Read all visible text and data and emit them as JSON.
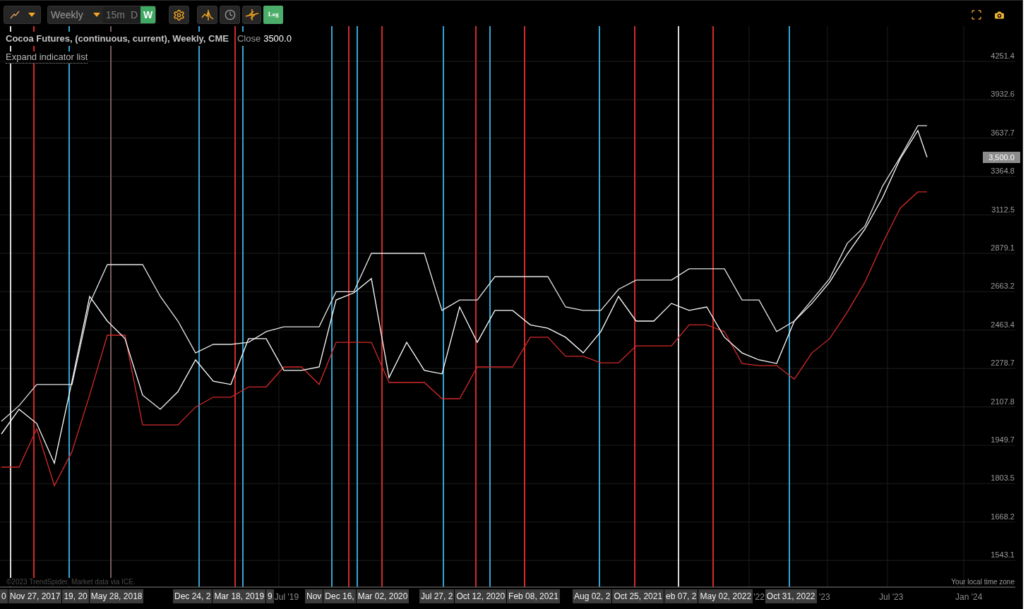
{
  "toolbar": {
    "interval_dropdown": "Weekly",
    "timeframes": [
      {
        "label": "15m",
        "selected": false
      },
      {
        "label": "D",
        "selected": false
      },
      {
        "label": "W",
        "selected": true
      }
    ],
    "log_toggle": {
      "label": "Log",
      "on": true
    }
  },
  "legend": {
    "title": "Cocoa Futures, (continuous, current), Weekly, CME",
    "close_label": "Close",
    "close_value": "3500.0",
    "expand_link": "Expand indicator list"
  },
  "price_axis": {
    "labels": [
      "4251.4",
      "3932.6",
      "3637.7",
      "3364.8",
      "3112.5",
      "2879.1",
      "2663.2",
      "2463.4",
      "2278.7",
      "2107.8",
      "1949.7",
      "1803.5",
      "1668.2",
      "1543.1"
    ],
    "last_price": "3,500.0"
  },
  "event_lines": [
    {
      "color": "#d9d9d9"
    },
    {
      "color": "#d42a2a"
    },
    {
      "color": "#34a6d4"
    },
    {
      "color": "#7a5c5c"
    },
    {
      "color": "#34a6d4"
    },
    {
      "color": "#d42a2a"
    },
    {
      "color": "#34a6d4"
    },
    {
      "color": "#34a6d4"
    },
    {
      "color": "#d42a2a"
    },
    {
      "color": "#34a6d4"
    },
    {
      "color": "#d42a2a"
    },
    {
      "color": "#34a6d4"
    },
    {
      "color": "#d42a2a"
    },
    {
      "color": "#34a6d4"
    },
    {
      "color": "#d42a2a"
    },
    {
      "color": "#34a6d4"
    },
    {
      "color": "#d42a2a"
    },
    {
      "color": "#d9d9d9"
    },
    {
      "color": "#d42a2a"
    },
    {
      "color": "#34a6d4"
    }
  ],
  "event_date_labels": [
    "0",
    "Nov 27, 2017",
    "19, 20",
    "May 28, 2018",
    "Dec 24, 2",
    "Mar 18, 2019",
    "9",
    "Nov",
    "Dec 16,",
    "Mar 02, 2020",
    "Jul 27, 2",
    "Oct 12, 2020",
    "Feb 08, 2021",
    "Aug 02, 2",
    "Oct 25, 2021",
    "eb 07, 2",
    "May 02, 2022",
    "Oct 31, 2022"
  ],
  "time_axis": {
    "labels": [
      "Jul '19",
      "'22",
      "'23",
      "Jul '23",
      "Jan '24"
    ],
    "note": "Your local time zone"
  },
  "copyright": "©2023 TrendSpider. Market data via ICE."
}
